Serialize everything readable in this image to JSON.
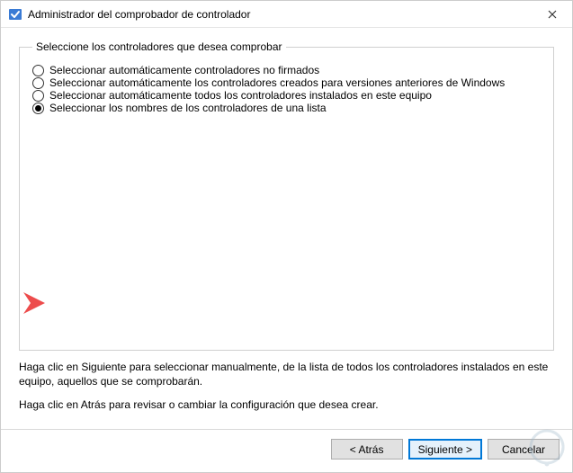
{
  "window": {
    "title": "Administrador del comprobador de controlador"
  },
  "group": {
    "legend": "Seleccione los controladores que desea comprobar",
    "options": [
      {
        "label": "Seleccionar automáticamente controladores no firmados",
        "selected": false
      },
      {
        "label": "Seleccionar automáticamente los controladores creados para versiones anteriores de Windows",
        "selected": false
      },
      {
        "label": "Seleccionar automáticamente todos los controladores instalados en este equipo",
        "selected": false
      },
      {
        "label": "Seleccionar los nombres de los controladores de una lista",
        "selected": true
      }
    ]
  },
  "helper": {
    "line1": "Haga clic en Siguiente para seleccionar manualmente, de la lista de todos los controladores instalados en este equipo, aquellos que se comprobarán.",
    "line2": "Haga clic en Atrás para revisar o cambiar la configuración que desea crear."
  },
  "buttons": {
    "back": "< Atrás",
    "next": "Siguiente >",
    "cancel": "Cancelar"
  },
  "colors": {
    "accent": "#0078d7",
    "arrow": "#ed4c4c"
  },
  "icons": {
    "app": "verifier-icon",
    "close": "close-icon",
    "watermark": "solvetic-watermark"
  }
}
